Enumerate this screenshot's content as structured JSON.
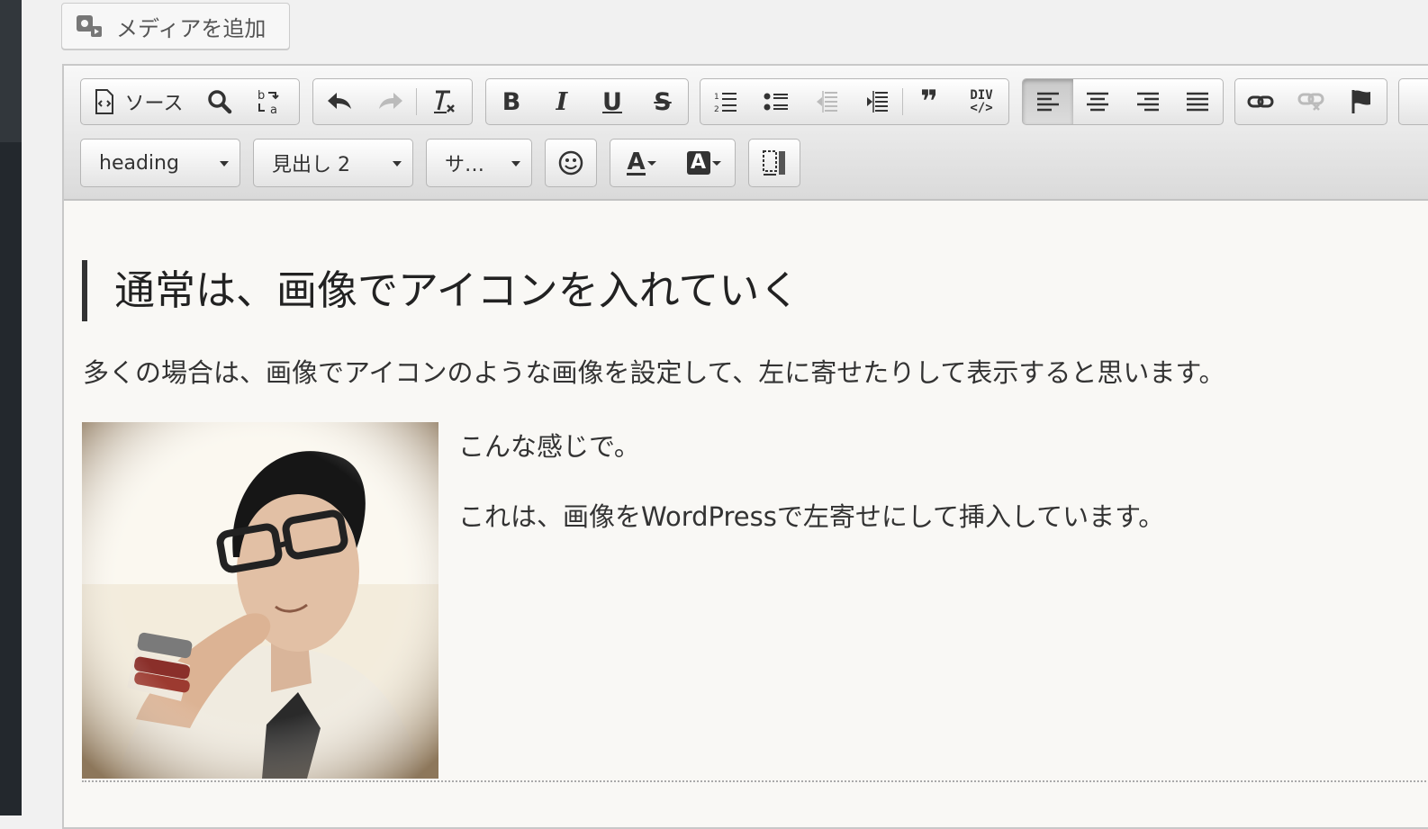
{
  "media_button": {
    "label": "メディアを追加",
    "icon": "media-add-icon"
  },
  "toolbar": {
    "source_label": "ソース",
    "icons_row1": [
      "source-icon",
      "search-icon",
      "replace-icon",
      "undo-icon",
      "redo-icon",
      "clear-format-icon",
      "bold-icon",
      "italic-icon",
      "underline-icon",
      "strikethrough-icon",
      "numbered-list-icon",
      "bullet-list-icon",
      "outdent-icon",
      "indent-icon",
      "blockquote-icon",
      "div-icon",
      "align-left-icon",
      "align-center-icon",
      "align-right-icon",
      "align-justify-icon",
      "link-icon",
      "unlink-icon",
      "anchor-flag-icon"
    ],
    "bold_glyph": "B",
    "italic_glyph": "I",
    "underline_glyph": "U",
    "strike_glyph": "S",
    "quote_glyph": "❞",
    "div_glyph_top": "DIV",
    "div_glyph_bottom": "</>",
    "style_combo": "heading",
    "format_combo": "見出し 2",
    "size_combo": "サ…",
    "emoji_icon": "smiley-icon",
    "text_color_glyph": "A",
    "bg_color_glyph": "A",
    "active_align": "left"
  },
  "content": {
    "heading": "通常は、画像でアイコンを入れていく",
    "paragraph1": "多くの場合は、画像でアイコンのような画像を設定して、左に寄せたりして表示すると思います。",
    "paragraph2": "こんな感じで。",
    "paragraph3": "これは、画像をWordPressで左寄せにして挿入しています。",
    "image": "portrait-photo"
  }
}
